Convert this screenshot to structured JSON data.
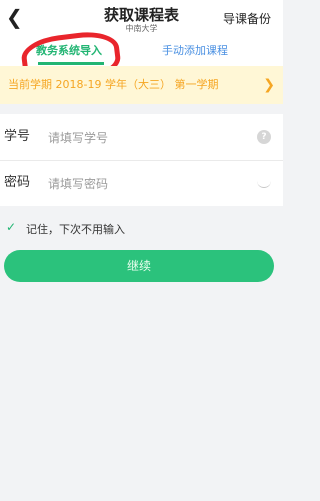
{
  "header": {
    "back_icon": "back-arrow-icon",
    "title": "获取课程表",
    "subtitle": "中南大学",
    "backup_label": "导课备份"
  },
  "tabs": [
    {
      "label": "教务系统导入",
      "active": true
    },
    {
      "label": "手动添加课程",
      "active": false
    }
  ],
  "notice": {
    "text": "当前学期 2018-19 学年（大三） 第一学期",
    "arrow_icon": "chevron-right-icon"
  },
  "form": {
    "student_id": {
      "label": "学号",
      "placeholder": "请填写学号",
      "icon": "help-icon"
    },
    "password": {
      "label": "密码",
      "placeholder": "请填写密码",
      "icon": "eye-closed-icon"
    }
  },
  "remember": {
    "label": "记住，下次不用输入",
    "checked": true,
    "icon": "check-icon"
  },
  "continue_label": "继续",
  "colors": {
    "accent": "#22b573",
    "button": "#2bc27c",
    "notice_bg": "#fff7d6",
    "notice_text": "#f5a623",
    "annotation": "#e9252c"
  }
}
